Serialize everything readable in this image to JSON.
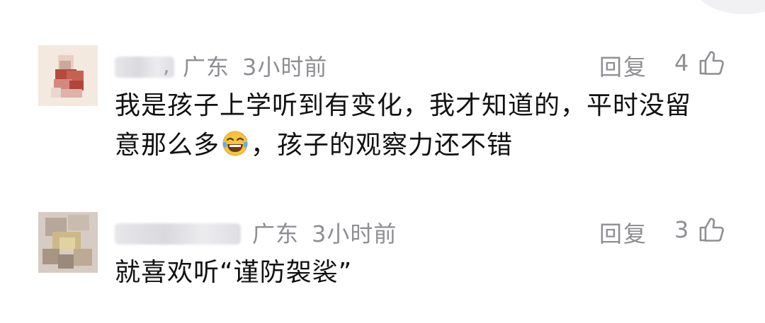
{
  "comments": [
    {
      "location": "广东",
      "time": "3小时前",
      "reply_label": "回复",
      "like_count": "4",
      "text_before_emoji": "我是孩子上学听到有变化，我才知道的，平时没留意那么多",
      "emoji": "laughing-tears-emoji",
      "text_after_emoji": "，孩子的观察力还不错"
    },
    {
      "location": "广东",
      "time": "3小时前",
      "reply_label": "回复",
      "like_count": "3",
      "text": "就喜欢听“谨防袈裟”"
    }
  ],
  "colors": {
    "meta_gray": "#8e8e93",
    "body_text": "#111111",
    "background": "#ffffff"
  }
}
